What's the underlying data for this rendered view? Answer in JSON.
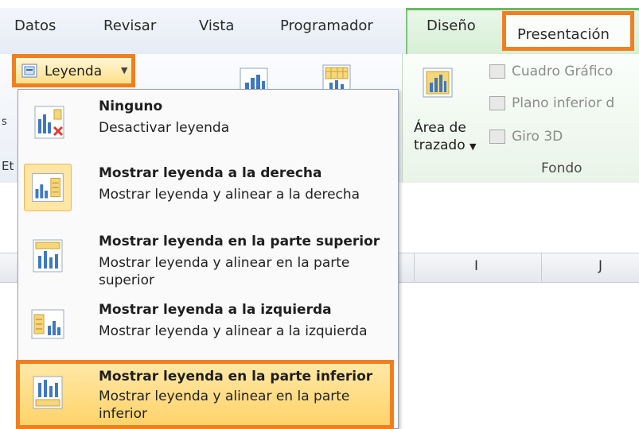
{
  "tabs": [
    "Datos",
    "Revisar",
    "Vista",
    "Programador",
    "Diseño",
    "Presentación"
  ],
  "ribbon": {
    "leyenda_label": "Leyenda",
    "area_label_line1": "Área de",
    "area_label_line2": "trazado",
    "fondo_items": [
      "Cuadro Gráfico",
      "Plano inferior d",
      "Giro 3D"
    ],
    "fondo_group": "Fondo",
    "left_fragment_1": "s",
    "left_fragment_2": "Et"
  },
  "sheet": {
    "columns": [
      "I",
      "J"
    ]
  },
  "menu": {
    "items": [
      {
        "title": "Ninguno",
        "desc": "Desactivar leyenda",
        "icon": "no-legend-icon"
      },
      {
        "title": "Mostrar leyenda a la derecha",
        "desc": "Mostrar leyenda y alinear a la derecha",
        "icon": "legend-right-icon"
      },
      {
        "title": "Mostrar leyenda en la parte superior",
        "desc": "Mostrar leyenda y alinear en la parte superior",
        "icon": "legend-top-icon"
      },
      {
        "title": "Mostrar leyenda a la izquierda",
        "desc": "Mostrar leyenda y alinear a la izquierda",
        "icon": "legend-left-icon"
      },
      {
        "title": "Mostrar leyenda en la parte inferior",
        "desc": "Mostrar leyenda y alinear en la parte inferior",
        "icon": "legend-bottom-icon"
      }
    ]
  },
  "colors": {
    "highlight_orange": "#f07f21",
    "hover_yellow": "#ffd36a",
    "context_green": "#6ab964"
  }
}
